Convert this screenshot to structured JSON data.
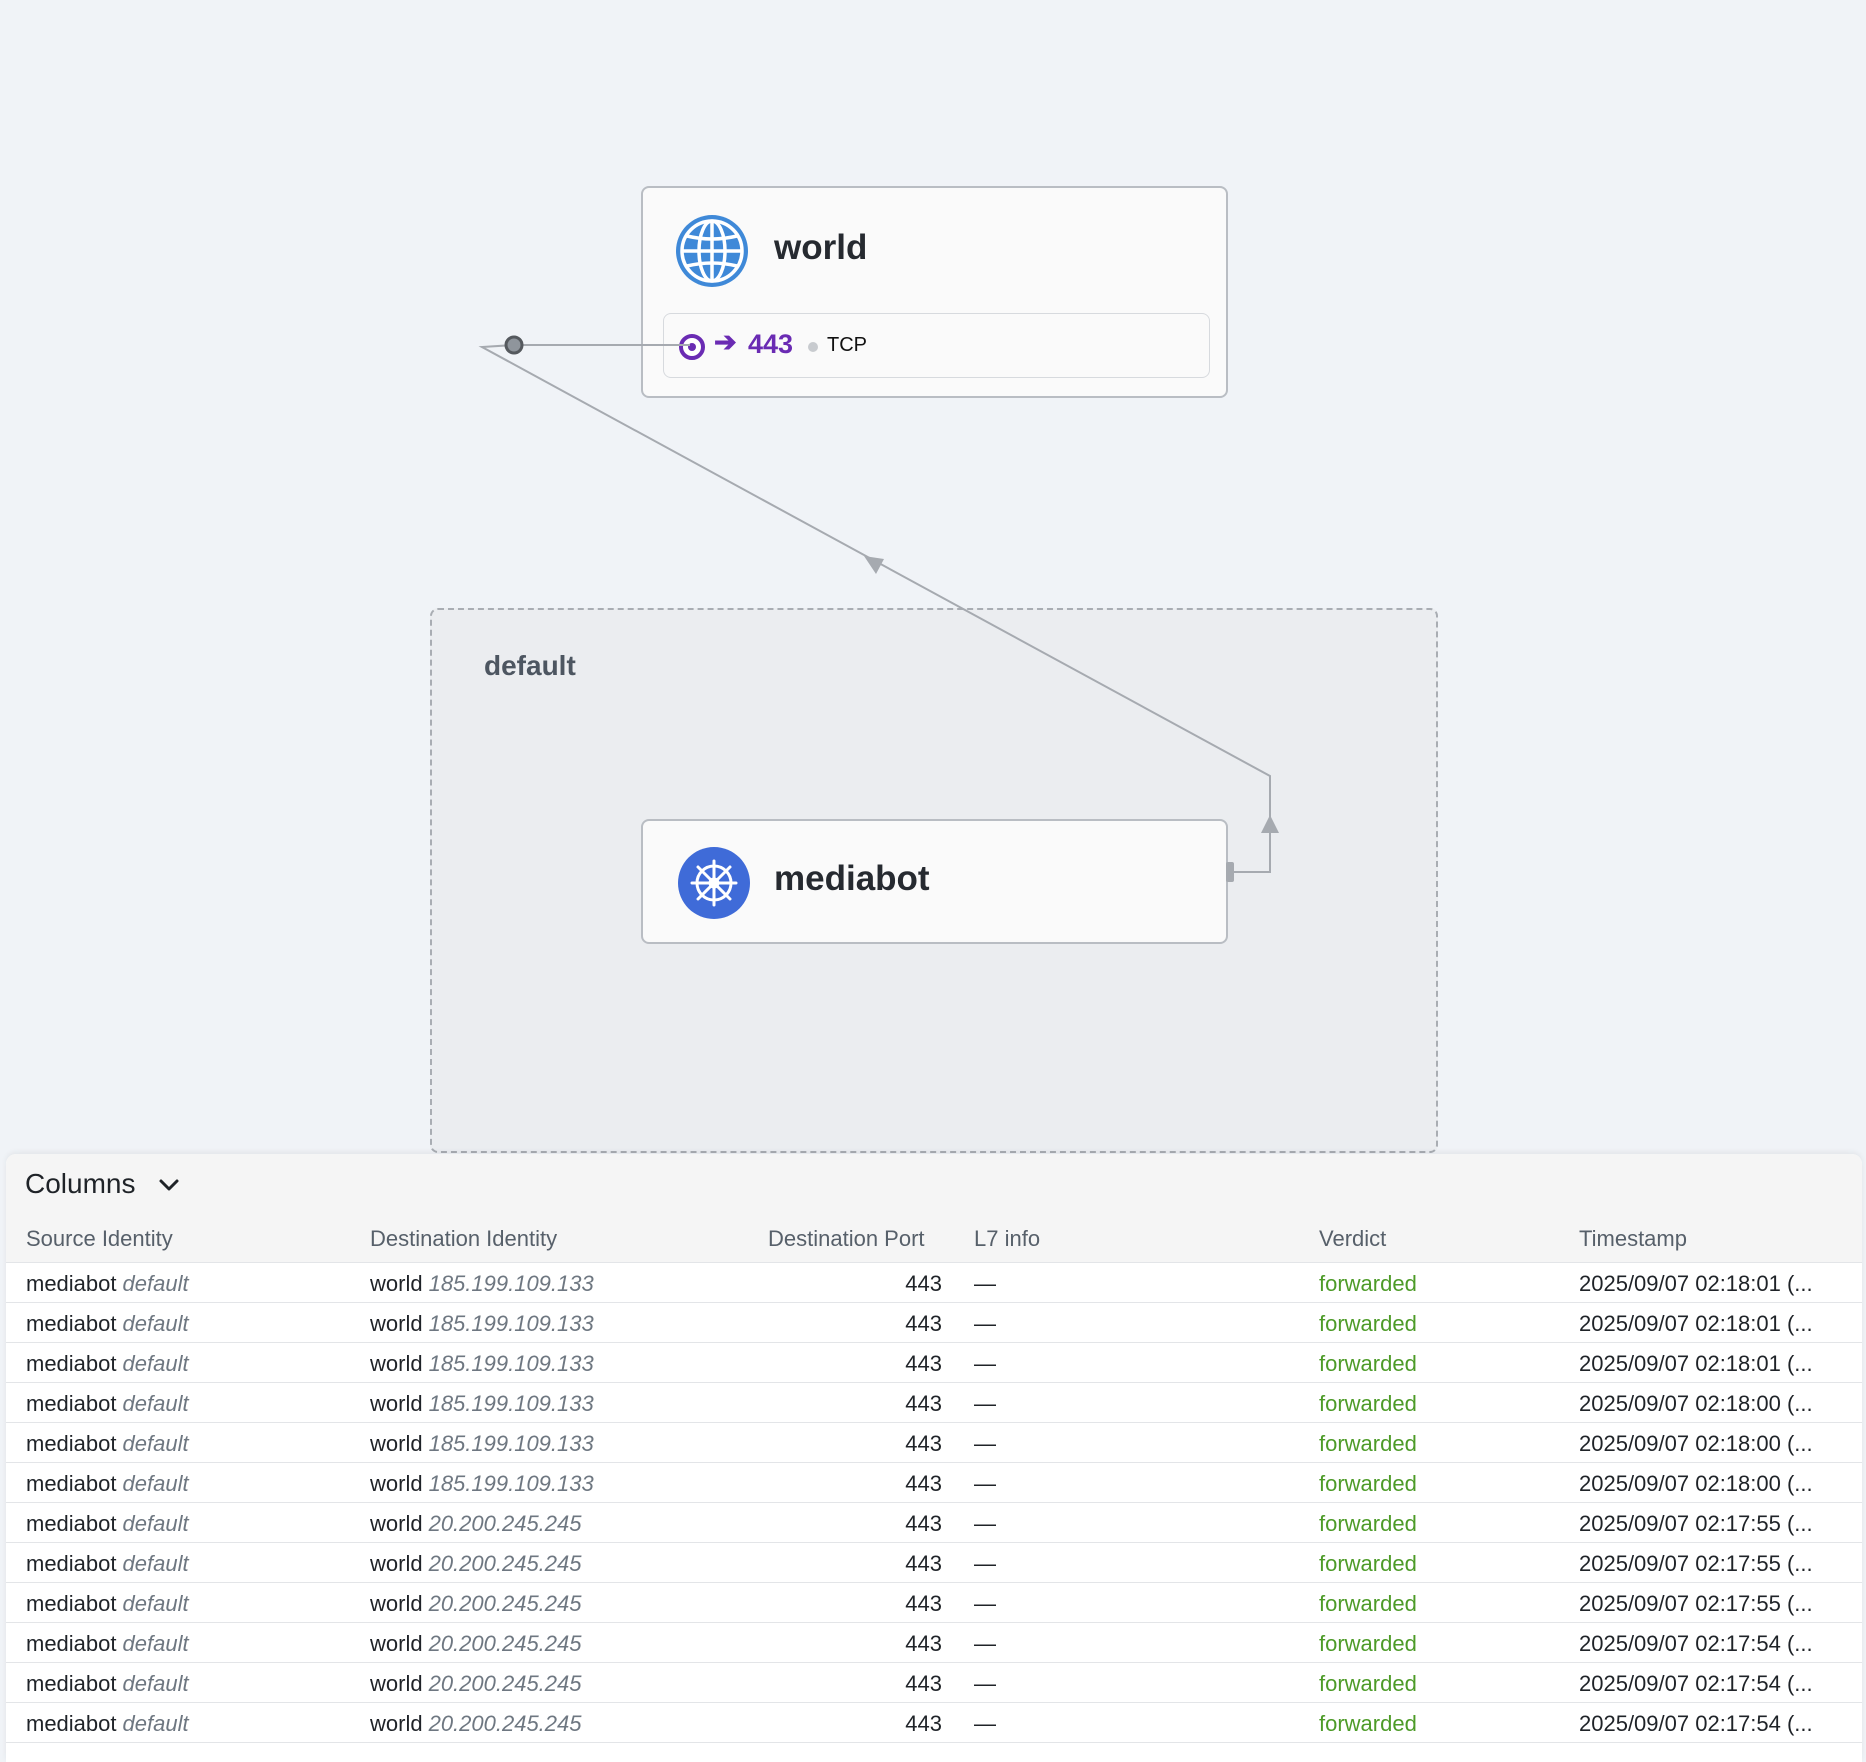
{
  "graph": {
    "namespace_label": "default",
    "nodes": {
      "world": {
        "title": "world",
        "icon": "globe-icon"
      },
      "mediabot": {
        "title": "mediabot",
        "icon": "kubernetes-icon"
      }
    },
    "port": {
      "arrow": "➔",
      "number": "443",
      "protocol": "TCP"
    }
  },
  "colors": {
    "verdict_forwarded": "#4d9b28",
    "port_accent": "#6a2bb3",
    "globe": "#3f89d8",
    "k8s": "#3f6bd8"
  },
  "table": {
    "columns_button": "Columns",
    "headers": {
      "source": "Source Identity",
      "destination": "Destination Identity",
      "port": "Destination Port",
      "l7": "L7 info",
      "verdict": "Verdict",
      "timestamp": "Timestamp"
    },
    "rows": [
      {
        "src": "mediabot",
        "src_ns": "default",
        "dst": "world",
        "dst_ip": "185.199.109.133",
        "port": "443",
        "l7": "—",
        "verdict": "forwarded",
        "ts": "2025/09/07 02:18:01 (..."
      },
      {
        "src": "mediabot",
        "src_ns": "default",
        "dst": "world",
        "dst_ip": "185.199.109.133",
        "port": "443",
        "l7": "—",
        "verdict": "forwarded",
        "ts": "2025/09/07 02:18:01 (..."
      },
      {
        "src": "mediabot",
        "src_ns": "default",
        "dst": "world",
        "dst_ip": "185.199.109.133",
        "port": "443",
        "l7": "—",
        "verdict": "forwarded",
        "ts": "2025/09/07 02:18:01 (..."
      },
      {
        "src": "mediabot",
        "src_ns": "default",
        "dst": "world",
        "dst_ip": "185.199.109.133",
        "port": "443",
        "l7": "—",
        "verdict": "forwarded",
        "ts": "2025/09/07 02:18:00 (..."
      },
      {
        "src": "mediabot",
        "src_ns": "default",
        "dst": "world",
        "dst_ip": "185.199.109.133",
        "port": "443",
        "l7": "—",
        "verdict": "forwarded",
        "ts": "2025/09/07 02:18:00 (..."
      },
      {
        "src": "mediabot",
        "src_ns": "default",
        "dst": "world",
        "dst_ip": "185.199.109.133",
        "port": "443",
        "l7": "—",
        "verdict": "forwarded",
        "ts": "2025/09/07 02:18:00 (..."
      },
      {
        "src": "mediabot",
        "src_ns": "default",
        "dst": "world",
        "dst_ip": "20.200.245.245",
        "port": "443",
        "l7": "—",
        "verdict": "forwarded",
        "ts": "2025/09/07 02:17:55 (..."
      },
      {
        "src": "mediabot",
        "src_ns": "default",
        "dst": "world",
        "dst_ip": "20.200.245.245",
        "port": "443",
        "l7": "—",
        "verdict": "forwarded",
        "ts": "2025/09/07 02:17:55 (..."
      },
      {
        "src": "mediabot",
        "src_ns": "default",
        "dst": "world",
        "dst_ip": "20.200.245.245",
        "port": "443",
        "l7": "—",
        "verdict": "forwarded",
        "ts": "2025/09/07 02:17:55 (..."
      },
      {
        "src": "mediabot",
        "src_ns": "default",
        "dst": "world",
        "dst_ip": "20.200.245.245",
        "port": "443",
        "l7": "—",
        "verdict": "forwarded",
        "ts": "2025/09/07 02:17:54 (..."
      },
      {
        "src": "mediabot",
        "src_ns": "default",
        "dst": "world",
        "dst_ip": "20.200.245.245",
        "port": "443",
        "l7": "—",
        "verdict": "forwarded",
        "ts": "2025/09/07 02:17:54 (..."
      },
      {
        "src": "mediabot",
        "src_ns": "default",
        "dst": "world",
        "dst_ip": "20.200.245.245",
        "port": "443",
        "l7": "—",
        "verdict": "forwarded",
        "ts": "2025/09/07 02:17:54 (..."
      }
    ]
  }
}
